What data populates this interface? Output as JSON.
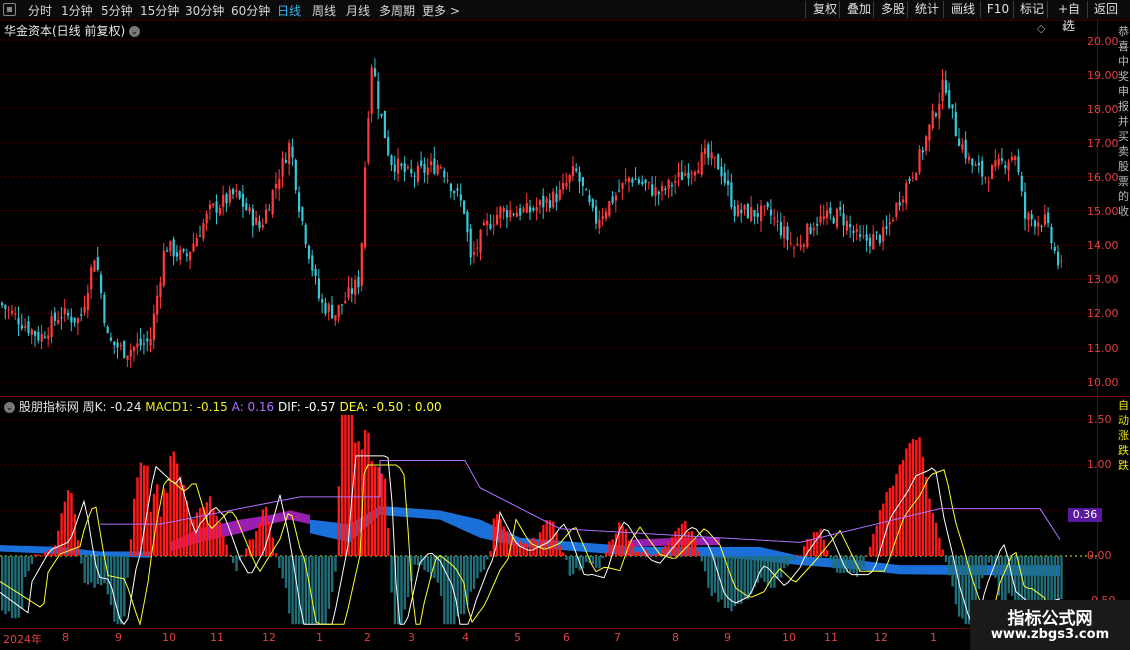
{
  "toolbar": {
    "periods": [
      "分时",
      "1分钟",
      "5分钟",
      "15分钟",
      "30分钟",
      "60分钟",
      "日线",
      "周线",
      "月线",
      "多周期"
    ],
    "active_period": "日线",
    "more": "更多 >",
    "right_buttons": [
      "复权",
      "叠加",
      "多股",
      "统计",
      "画线",
      "F10",
      "标记",
      "+自选",
      "返回"
    ]
  },
  "main": {
    "title": "华金资本(日线 前复权)",
    "y_ticks": [
      "20.00",
      "19.00",
      "18.00",
      "17.00",
      "16.00",
      "15.00",
      "14.00",
      "13.00",
      "12.00",
      "11.00",
      "10.00"
    ]
  },
  "indicator": {
    "name": "股朋指标网",
    "fields": [
      {
        "label": "周K: -0.24",
        "color": "#e8e8e8"
      },
      {
        "label": "MACD1: -0.15",
        "color": "#e8e820"
      },
      {
        "label": "A: 0.16",
        "color": "#b070ff"
      },
      {
        "label": "DIF: -0.57",
        "color": "#ffffff"
      },
      {
        "label": "DEA: -0.50",
        "color": "#ffff30"
      },
      {
        "label": ": 0.00",
        "color": "#ffff30"
      }
    ],
    "y_ticks": [
      "1.50",
      "1.00",
      "0.50",
      "0.00",
      "-0.50"
    ],
    "price_tag": "0.36"
  },
  "x_axis": [
    "2024年",
    "8",
    "9",
    "10",
    "11",
    "12",
    "1",
    "2",
    "3",
    "4",
    "5",
    "6",
    "7",
    "8",
    "9",
    "10",
    "11",
    "12",
    "1"
  ],
  "side_strip": {
    "top_text": "恭喜中奖申报并买卖股票的收",
    "bottom_text": "自动涨跌跌"
  },
  "watermark": {
    "line1": "指标公式网",
    "line2": "www.zbgs3.com"
  },
  "colors": {
    "up": "#ff3b3b",
    "down": "#35c8d8",
    "grid": "#6a0000",
    "macd_up": "#ff1a1a",
    "macd_down": "#1f6e78",
    "band_purple": "#9a1fb0",
    "band_blue": "#1a6fd8"
  }
}
